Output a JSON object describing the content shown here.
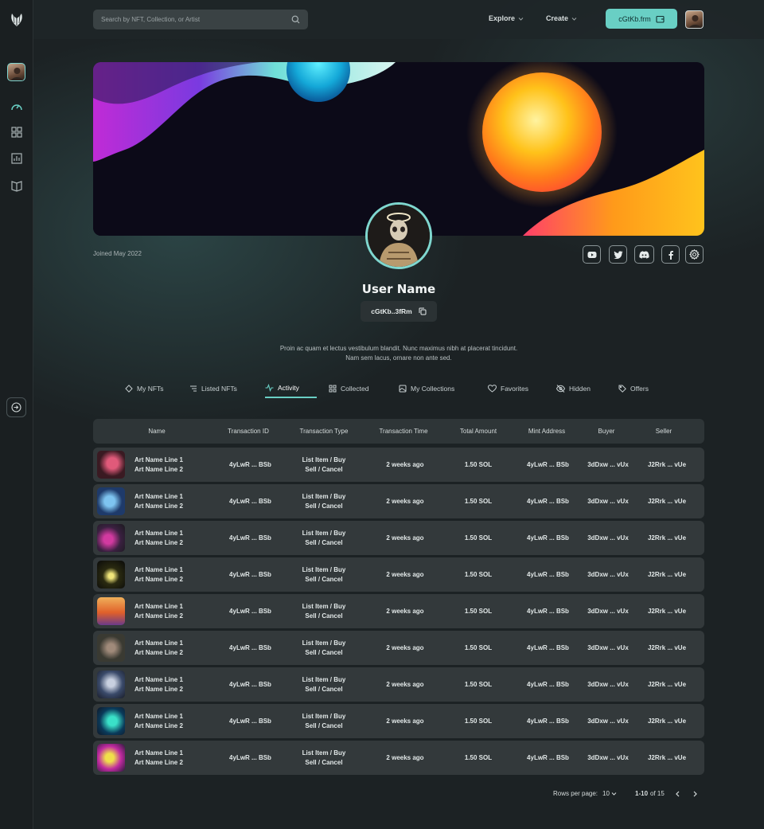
{
  "search": {
    "placeholder": "Search by NFT, Collection, or Artist"
  },
  "nav": {
    "explore": "Explore",
    "create": "Create"
  },
  "wallet": {
    "label": "cGtKb.frm"
  },
  "profile": {
    "joined": "Joined May 2022",
    "username": "User Name",
    "address": "cGtKb..3fRm",
    "bio": "Proin ac quam et lectus vestibulum blandit. Nunc maximus nibh at placerat tincidunt. Nam sem lacus, ornare non ante sed."
  },
  "socials": [
    "youtube-icon",
    "twitter-icon",
    "discord-icon",
    "facebook-icon",
    "settings-icon"
  ],
  "tabs": [
    {
      "label": "My NFTs",
      "icon": "diamond-icon"
    },
    {
      "label": "Listed NFTs",
      "icon": "list-icon"
    },
    {
      "label": "Activity",
      "icon": "activity-icon",
      "active": true
    },
    {
      "label": "Collected",
      "icon": "grid-icon"
    },
    {
      "label": "My Collections",
      "icon": "collection-icon"
    },
    {
      "label": "Favorites",
      "icon": "heart-icon"
    },
    {
      "label": "Hidden",
      "icon": "eye-off-icon"
    },
    {
      "label": "Offers",
      "icon": "tag-icon"
    }
  ],
  "table": {
    "headers": [
      "Name",
      "Transaction ID",
      "Transaction Type",
      "Transaction Time",
      "Total Amount",
      "Mint Address",
      "Buyer",
      "Seller"
    ],
    "rows": [
      {
        "name1": "Art Name Line 1",
        "name2": "Art Name Line 2",
        "txid": "4yLwR ... BSb",
        "type1": "List Item / Buy",
        "type2": "Sell / Cancel",
        "time": "2 weeks ago",
        "amount": "1.50 SOL",
        "mint": "4yLwR ... BSb",
        "buyer": "3dDxw ... vUx",
        "seller": "J2Rrk ... vUe"
      },
      {
        "name1": "Art Name Line 1",
        "name2": "Art Name Line 2",
        "txid": "4yLwR ... BSb",
        "type1": "List Item / Buy",
        "type2": "Sell / Cancel",
        "time": "2 weeks ago",
        "amount": "1.50 SOL",
        "mint": "4yLwR ... BSb",
        "buyer": "3dDxw ... vUx",
        "seller": "J2Rrk ... vUe"
      },
      {
        "name1": "Art Name Line 1",
        "name2": "Art Name Line 2",
        "txid": "4yLwR ... BSb",
        "type1": "List Item / Buy",
        "type2": "Sell / Cancel",
        "time": "2 weeks ago",
        "amount": "1.50 SOL",
        "mint": "4yLwR ... BSb",
        "buyer": "3dDxw ... vUx",
        "seller": "J2Rrk ... vUe"
      },
      {
        "name1": "Art Name Line 1",
        "name2": "Art Name Line 2",
        "txid": "4yLwR ... BSb",
        "type1": "List Item / Buy",
        "type2": "Sell / Cancel",
        "time": "2 weeks ago",
        "amount": "1.50 SOL",
        "mint": "4yLwR ... BSb",
        "buyer": "3dDxw ... vUx",
        "seller": "J2Rrk ... vUe"
      },
      {
        "name1": "Art Name Line 1",
        "name2": "Art Name Line 2",
        "txid": "4yLwR ... BSb",
        "type1": "List Item / Buy",
        "type2": "Sell / Cancel",
        "time": "2 weeks ago",
        "amount": "1.50 SOL",
        "mint": "4yLwR ... BSb",
        "buyer": "3dDxw ... vUx",
        "seller": "J2Rrk ... vUe"
      },
      {
        "name1": "Art Name Line 1",
        "name2": "Art Name Line 2",
        "txid": "4yLwR ... BSb",
        "type1": "List Item / Buy",
        "type2": "Sell / Cancel",
        "time": "2 weeks ago",
        "amount": "1.50 SOL",
        "mint": "4yLwR ... BSb",
        "buyer": "3dDxw ... vUx",
        "seller": "J2Rrk ... vUe"
      },
      {
        "name1": "Art Name Line 1",
        "name2": "Art Name Line 2",
        "txid": "4yLwR ... BSb",
        "type1": "List Item / Buy",
        "type2": "Sell / Cancel",
        "time": "2 weeks ago",
        "amount": "1.50 SOL",
        "mint": "4yLwR ... BSb",
        "buyer": "3dDxw ... vUx",
        "seller": "J2Rrk ... vUe"
      },
      {
        "name1": "Art Name Line 1",
        "name2": "Art Name Line 2",
        "txid": "4yLwR ... BSb",
        "type1": "List Item / Buy",
        "type2": "Sell / Cancel",
        "time": "2 weeks ago",
        "amount": "1.50 SOL",
        "mint": "4yLwR ... BSb",
        "buyer": "3dDxw ... vUx",
        "seller": "J2Rrk ... vUe"
      },
      {
        "name1": "Art Name Line 1",
        "name2": "Art Name Line 2",
        "txid": "4yLwR ... BSb",
        "type1": "List Item / Buy",
        "type2": "Sell / Cancel",
        "time": "2 weeks ago",
        "amount": "1.50 SOL",
        "mint": "4yLwR ... BSb",
        "buyer": "3dDxw ... vUx",
        "seller": "J2Rrk ... vUe"
      }
    ]
  },
  "pagination": {
    "rows_label": "Rows per page:",
    "rows_value": "10",
    "range": "1-10",
    "of_label": "of 15"
  },
  "colors": {
    "accent": "#69cfc4",
    "background": "#1c2224",
    "row": "#33393b"
  }
}
